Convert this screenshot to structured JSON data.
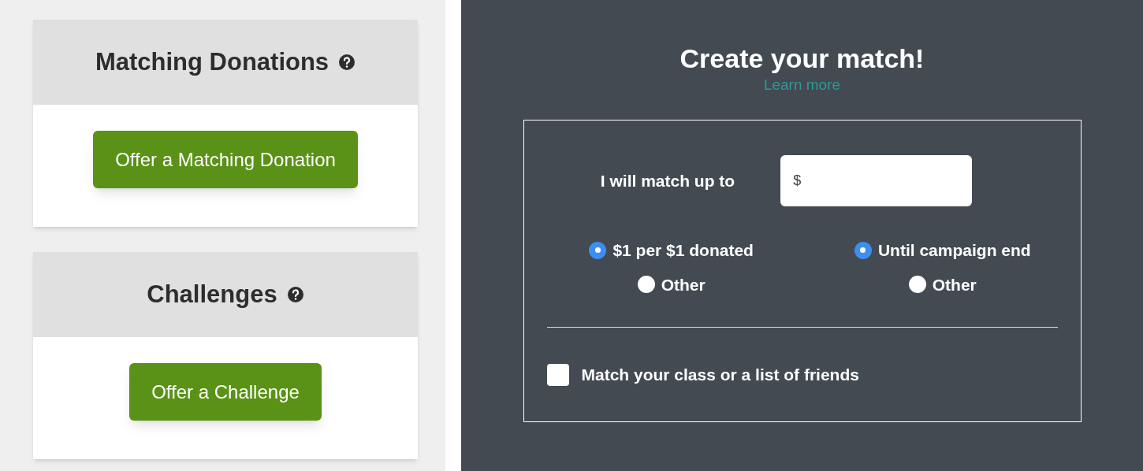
{
  "cards": [
    {
      "title": "Matching Donations",
      "help": true,
      "button": "Offer a Matching Donation"
    },
    {
      "title": "Challenges",
      "help": true,
      "button": "Offer a Challenge"
    }
  ],
  "match_form": {
    "title": "Create your match!",
    "learn_more": "Learn more",
    "amount_label": "I will match up to",
    "amount_placeholder": "$",
    "radio_groups": [
      {
        "options": [
          {
            "label": "$1 per $1 donated",
            "selected": true
          },
          {
            "label": "Other",
            "selected": false
          }
        ]
      },
      {
        "options": [
          {
            "label": "Until campaign end",
            "selected": true
          },
          {
            "label": "Other",
            "selected": false
          }
        ]
      }
    ],
    "checkbox": {
      "label": "Match your class or a list of friends",
      "checked": false
    }
  }
}
